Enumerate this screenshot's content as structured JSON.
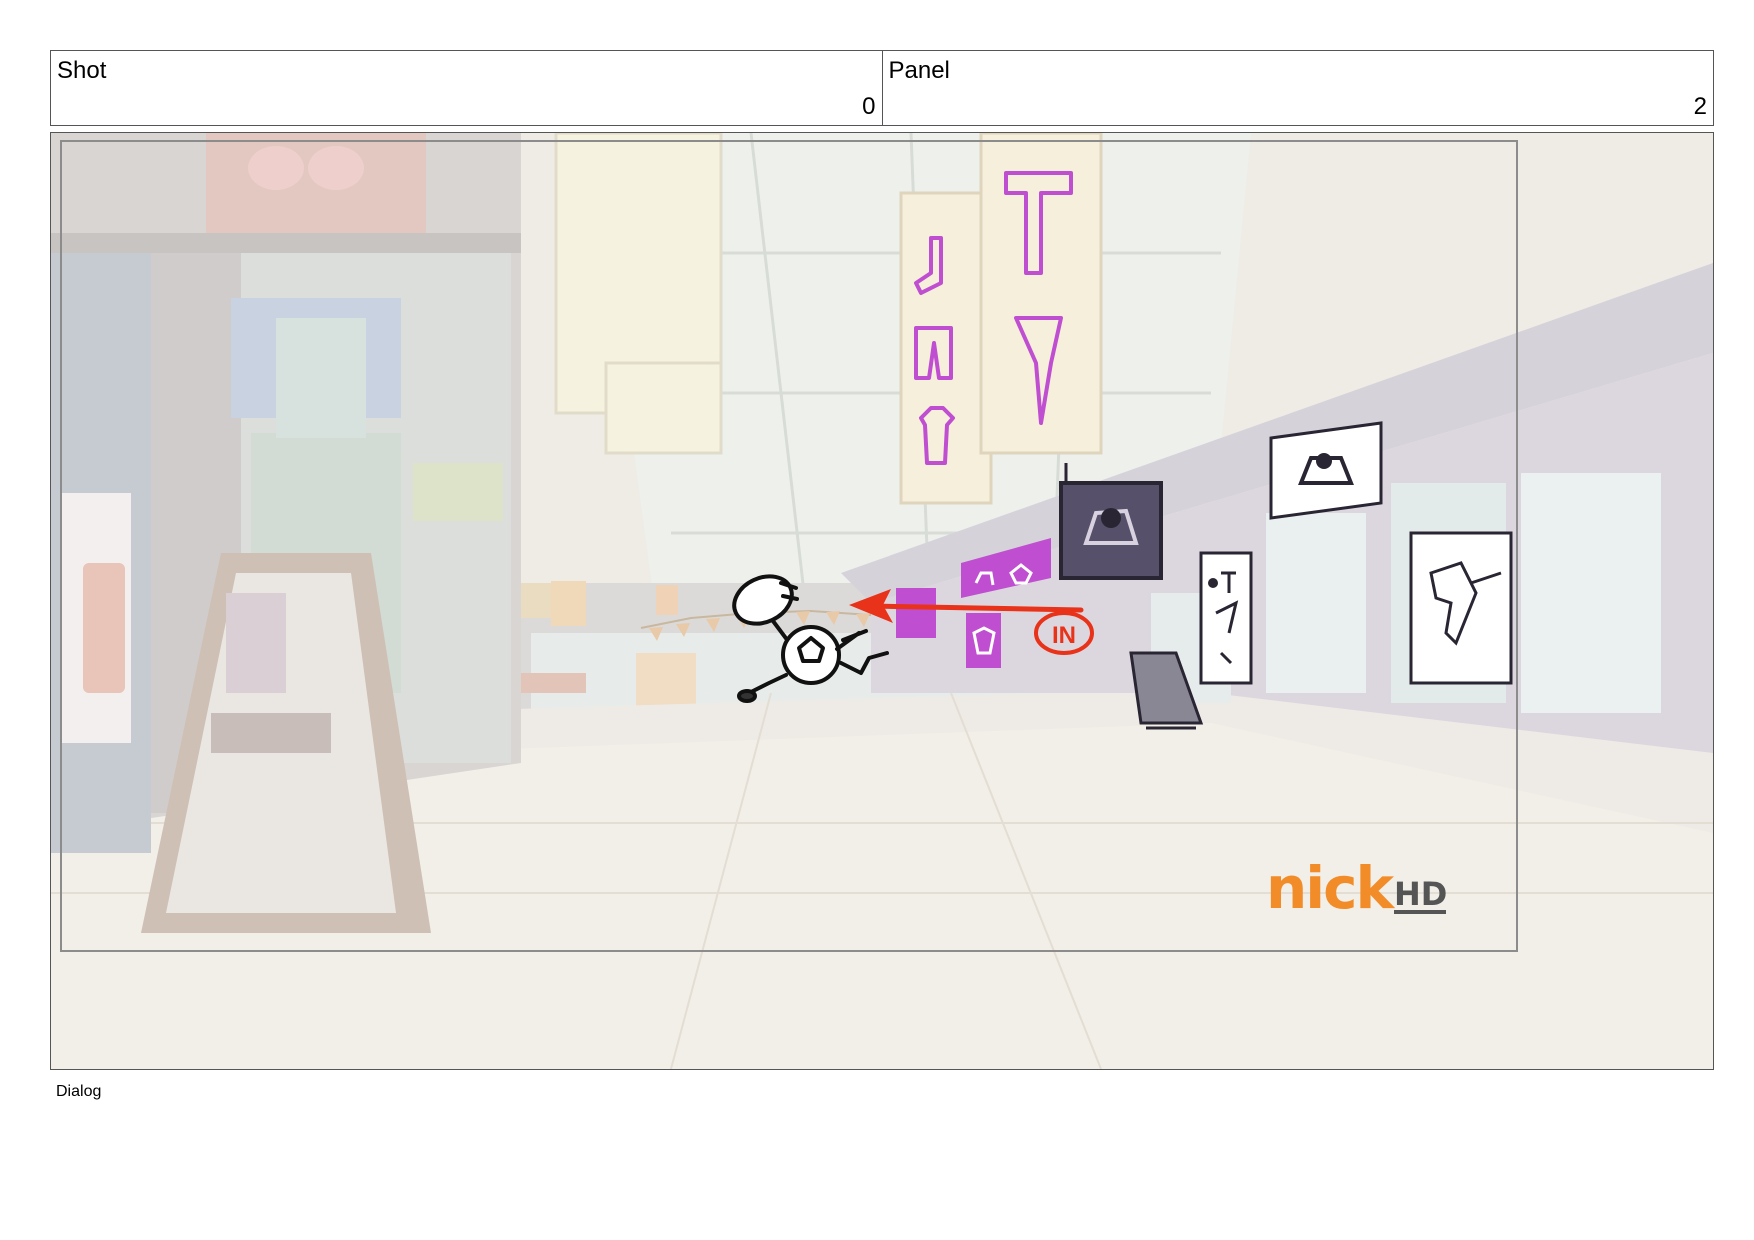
{
  "header": {
    "shot_label": "Shot",
    "shot_value": "0",
    "panel_label": "Panel",
    "panel_value": "2"
  },
  "panel": {
    "annotation_text": "IN",
    "logo": {
      "brand": "nick",
      "suffix": "HD"
    }
  },
  "colors": {
    "accent_red": "#e8321a",
    "logo_orange": "#f28c28",
    "sign_magenta": "#c04ed0"
  },
  "footer": {
    "dialog_label": "Dialog"
  }
}
